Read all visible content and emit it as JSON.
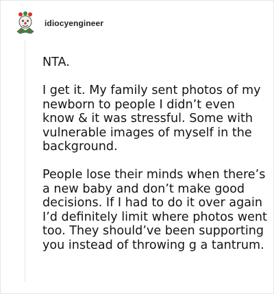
{
  "post": {
    "username": "idiocyengineer",
    "paragraphs": [
      "NTA.",
      "I get it. My family sent photos of my newborn to people I didn’t even know & it was stressful. Some with vulnerable images of myself in the background.",
      "People lose their minds when there’s a new baby and don’t make good decisions. If I had to do it over again I’d definitely limit where photos went too. They should’ve been supporting you instead of throwing g a tantrum."
    ]
  },
  "avatar": {
    "icon": "clown-avatar-icon",
    "colors": {
      "hat": "#d9332b",
      "collar": "#2f8f3a",
      "face": "#f2efe6",
      "outline": "#555555"
    }
  }
}
